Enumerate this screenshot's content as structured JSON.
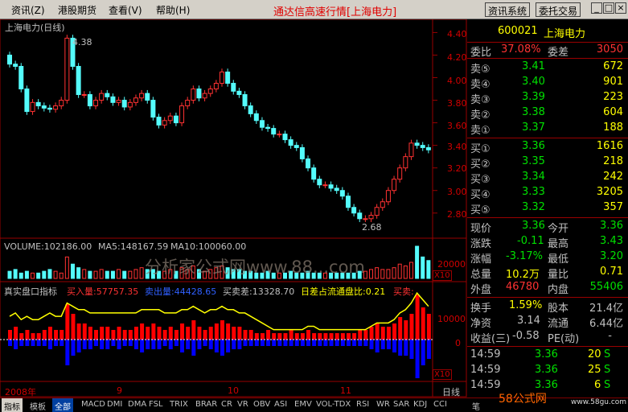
{
  "menu": {
    "items": [
      "资讯(Z)",
      "港股期货",
      "查看(V)",
      "帮助(H)"
    ],
    "title": "通达信高速行情[上海电力]",
    "btn1": "资讯系统",
    "btn2": "委托交易"
  },
  "chart": {
    "title": "上海电力(日线)",
    "price_axis": [
      "4.40",
      "4.20",
      "4.00",
      "3.80",
      "3.60",
      "3.40",
      "3.20",
      "3.00",
      "2.80"
    ],
    "high_mark": "4.38",
    "low_mark": "2.68",
    "vol_title": "VOLUME:102186.00",
    "ma5": "MA5:148167.59",
    "ma10": "MA10:100060.00",
    "vol_axis": "20000",
    "x10a": "X10",
    "x10b": "X10",
    "ind_name": "真实盘口指标",
    "buy": "买入量:57757.35",
    "sell": "卖出量:44428.65",
    "diff": "买卖差:13328.70",
    "ratio": "日差占流通盘比:0.21",
    "more": "买卖:",
    "ind_axis": [
      "10000",
      "0"
    ],
    "watermark": "分析家公式网www.88...com",
    "dates": [
      "2008年",
      "9",
      "10",
      "11"
    ]
  },
  "chart_data": {
    "type": "candlestick",
    "ylim": [
      2.62,
      4.46
    ],
    "opens": [
      4.2,
      4.12,
      4.1,
      3.9,
      3.7,
      3.78,
      3.75,
      3.73,
      3.72,
      3.75,
      3.8,
      4.35,
      4.1,
      3.85,
      3.85,
      3.75,
      3.8,
      3.86,
      3.83,
      3.78,
      3.8,
      3.74,
      3.78,
      3.82,
      3.86,
      3.8,
      3.65,
      3.58,
      3.62,
      3.66,
      3.6,
      3.75,
      3.8,
      3.9,
      3.82,
      3.86,
      3.9,
      3.95,
      4.05,
      3.95,
      3.88,
      3.85,
      3.75,
      3.68,
      3.62,
      3.56,
      3.55,
      3.5,
      3.5,
      3.45,
      3.4,
      3.38,
      3.28,
      3.2,
      3.1,
      3.05,
      3.05,
      3.02,
      3.0,
      2.95,
      2.85,
      2.8,
      2.75,
      2.75,
      2.78,
      2.85,
      2.9,
      3.0,
      3.1,
      3.2,
      3.3,
      3.42,
      3.4,
      3.38
    ],
    "closes": [
      4.12,
      4.1,
      3.9,
      3.7,
      3.78,
      3.75,
      3.73,
      3.72,
      3.75,
      3.8,
      4.35,
      4.1,
      3.85,
      3.85,
      3.75,
      3.8,
      3.86,
      3.83,
      3.78,
      3.8,
      3.74,
      3.78,
      3.82,
      3.86,
      3.8,
      3.65,
      3.58,
      3.62,
      3.66,
      3.6,
      3.75,
      3.8,
      3.9,
      3.82,
      3.86,
      3.9,
      3.95,
      4.05,
      3.95,
      3.88,
      3.85,
      3.75,
      3.68,
      3.62,
      3.56,
      3.55,
      3.5,
      3.5,
      3.45,
      3.4,
      3.38,
      3.28,
      3.2,
      3.1,
      3.05,
      3.05,
      3.02,
      3.0,
      2.95,
      2.85,
      2.8,
      2.75,
      2.75,
      2.78,
      2.85,
      2.9,
      3.0,
      3.1,
      3.2,
      3.3,
      3.42,
      3.4,
      3.38,
      3.36
    ],
    "volumes": [
      4,
      5,
      3,
      4,
      3,
      3,
      4,
      5,
      4,
      3,
      12,
      8,
      6,
      5,
      4,
      4,
      5,
      4,
      4,
      5,
      4,
      4,
      5,
      6,
      5,
      5,
      4,
      4,
      5,
      4,
      6,
      5,
      7,
      5,
      4,
      5,
      6,
      7,
      6,
      5,
      5,
      4,
      4,
      3,
      3,
      4,
      3,
      3,
      3,
      4,
      3,
      3,
      4,
      3,
      3,
      3,
      3,
      3,
      3,
      3,
      3,
      4,
      4,
      5,
      6,
      5,
      5,
      6,
      8,
      7,
      9,
      18,
      12,
      10
    ],
    "ind_buy": [
      3,
      4,
      2,
      3,
      2,
      2,
      3,
      4,
      3,
      3,
      11,
      8,
      5,
      5,
      4,
      3,
      4,
      4,
      3,
      4,
      3,
      3,
      4,
      5,
      4,
      5,
      4,
      3,
      4,
      3,
      5,
      4,
      6,
      4,
      3,
      4,
      5,
      6,
      5,
      4,
      4,
      3,
      3,
      2,
      2,
      3,
      2,
      2,
      2,
      3,
      2,
      2,
      3,
      2,
      2,
      2,
      2,
      2,
      2,
      2,
      2,
      3,
      3,
      4,
      5,
      4,
      4,
      5,
      7,
      6,
      8,
      14,
      10,
      8
    ],
    "ind_sell": [
      2,
      3,
      2,
      2,
      2,
      2,
      2,
      3,
      2,
      2,
      8,
      5,
      4,
      3,
      3,
      2,
      3,
      3,
      2,
      3,
      2,
      2,
      3,
      4,
      3,
      3,
      3,
      2,
      3,
      2,
      4,
      3,
      5,
      3,
      2,
      3,
      4,
      5,
      4,
      3,
      3,
      2,
      2,
      2,
      2,
      2,
      2,
      2,
      2,
      2,
      2,
      2,
      2,
      2,
      2,
      2,
      2,
      2,
      2,
      2,
      2,
      2,
      2,
      3,
      4,
      3,
      3,
      4,
      5,
      5,
      6,
      12,
      8,
      6
    ],
    "ind_line": [
      7,
      8,
      6,
      7,
      6,
      6,
      7,
      8,
      7,
      7,
      11,
      10,
      9,
      9,
      8,
      8,
      8,
      8,
      8,
      8,
      8,
      8,
      8,
      9,
      9,
      9,
      9,
      8,
      8,
      8,
      9,
      9,
      10,
      9,
      8,
      9,
      9,
      10,
      9,
      9,
      8,
      8,
      7,
      6,
      5,
      4,
      3,
      3,
      3,
      3,
      3,
      3,
      4,
      4,
      3,
      3,
      3,
      3,
      3,
      3,
      3,
      3,
      3,
      4,
      5,
      5,
      5,
      6,
      8,
      9,
      11,
      14,
      12,
      10
    ],
    "ind_line_ylim": [
      0,
      15
    ],
    "xlim": [
      0,
      74
    ],
    "price_axis_ticks": [
      4.4,
      4.2,
      4.0,
      3.8,
      3.6,
      3.4,
      3.2,
      3.0,
      2.8
    ]
  },
  "quote": {
    "code": "600021",
    "name": "上海电力",
    "wb_label": "委比",
    "wb": "37.08%",
    "wc_label": "委差",
    "wc": "3050",
    "asks": [
      {
        "l": "卖⑤",
        "p": "3.41",
        "v": "672"
      },
      {
        "l": "卖④",
        "p": "3.40",
        "v": "901"
      },
      {
        "l": "卖③",
        "p": "3.39",
        "v": "223"
      },
      {
        "l": "卖②",
        "p": "3.38",
        "v": "604"
      },
      {
        "l": "卖①",
        "p": "3.37",
        "v": "188"
      }
    ],
    "bids": [
      {
        "l": "买①",
        "p": "3.36",
        "v": "1616"
      },
      {
        "l": "买②",
        "p": "3.35",
        "v": "218"
      },
      {
        "l": "买③",
        "p": "3.34",
        "v": "242"
      },
      {
        "l": "买④",
        "p": "3.33",
        "v": "3205"
      },
      {
        "l": "买⑤",
        "p": "3.32",
        "v": "357"
      }
    ],
    "s": [
      {
        "a": "现价",
        "b": "3.36",
        "c": "今开",
        "d": "3.36"
      },
      {
        "a": "涨跌",
        "b": "-0.11",
        "c": "最高",
        "d": "3.43"
      },
      {
        "a": "涨幅",
        "b": "-3.17%",
        "c": "最低",
        "d": "3.20"
      },
      {
        "a": "总量",
        "b": "10.2万",
        "c": "量比",
        "d": "0.71"
      },
      {
        "a": "外盘",
        "b": "46780",
        "c": "内盘",
        "d": "55406"
      }
    ],
    "f": [
      {
        "a": "换手",
        "b": "1.59%",
        "c": "股本",
        "d": "21.4亿"
      },
      {
        "a": "净资",
        "b": "3.14",
        "c": "流通",
        "d": "6.44亿"
      },
      {
        "a": "收益(三)",
        "b": "-0.58",
        "c": "PE(动)",
        "d": "-"
      }
    ],
    "ticks": [
      {
        "t": "14:59",
        "p": "3.36",
        "v": "20",
        "s": "S"
      },
      {
        "t": "14:59",
        "p": "3.36",
        "v": "25",
        "s": "S"
      },
      {
        "t": "14:59",
        "p": "3.36",
        "v": "6",
        "s": "S"
      }
    ]
  },
  "tabs": [
    "指标",
    "模板",
    "全部",
    "MACD",
    "DMI",
    "DMA",
    "FSL",
    "TRIX",
    "BRAR",
    "CR",
    "VR",
    "OBV",
    "ASI",
    "EMV",
    "VOL-TDX",
    "RSI",
    "WR",
    "SAR",
    "KDJ",
    "CCI"
  ],
  "period": "日线",
  "bi": "笔",
  "brand": "58公式网",
  "brand_url": "www.58gu.com",
  "colors": {
    "up": "#ff3232",
    "down": "#54fcfc",
    "buy": "#ff0000",
    "sell": "#0000ff",
    "line": "#ffff00"
  }
}
